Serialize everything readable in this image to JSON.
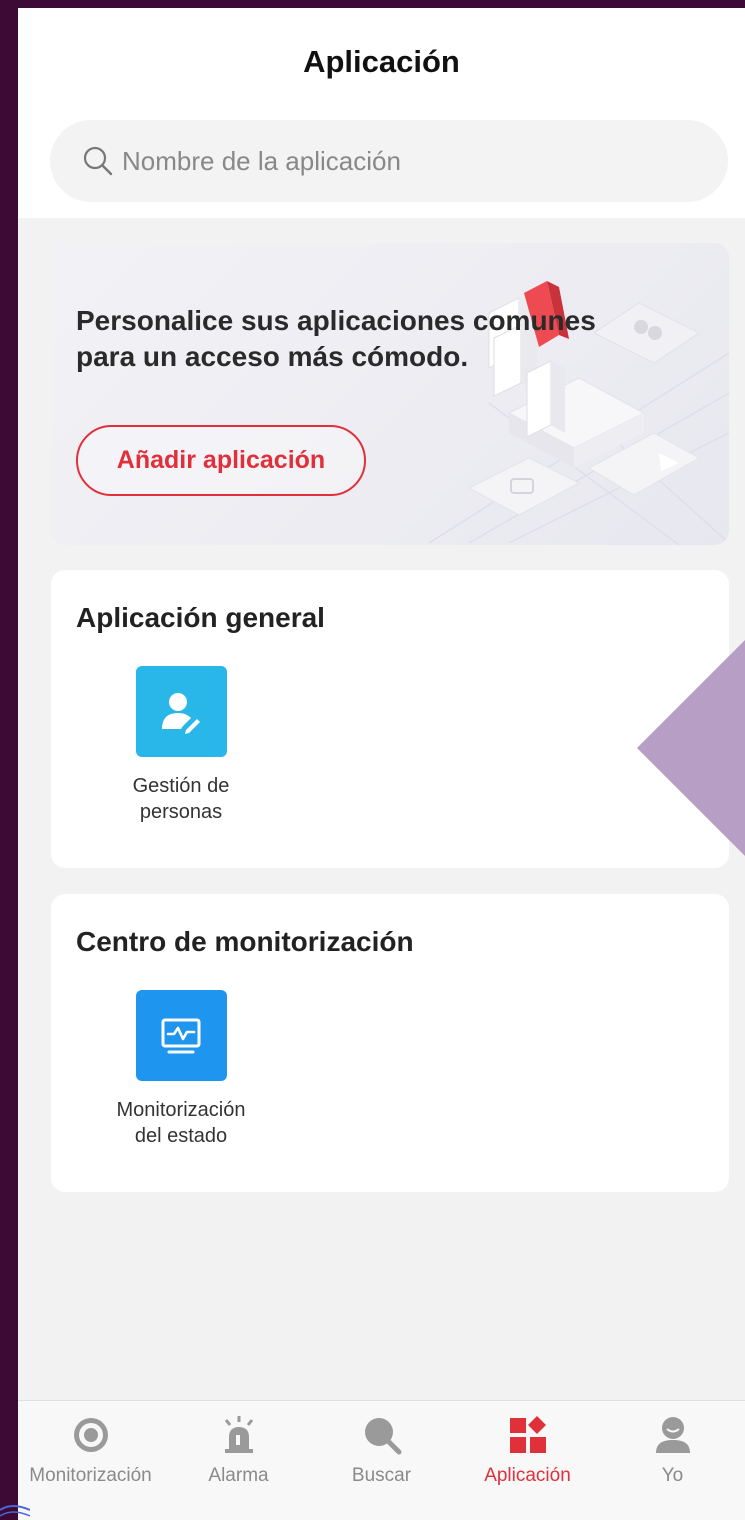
{
  "header": {
    "title": "Aplicación",
    "search_placeholder": "Nombre de la aplicación"
  },
  "promo": {
    "text_line1": "Personalice sus aplicaciones comunes",
    "text_line2": "para un acceso más cómodo.",
    "button_label": "Añadir aplicación"
  },
  "sections": [
    {
      "title": "Aplicación general",
      "apps": [
        {
          "label_line1": "Gestión de",
          "label_line2": "personas",
          "icon": "person-edit-icon",
          "color": "#29b6e8"
        }
      ]
    },
    {
      "title": "Centro de monitorización",
      "apps": [
        {
          "label_line1": "Monitorización",
          "label_line2": "del estado",
          "icon": "status-monitor-icon",
          "color": "#1e96f0"
        }
      ]
    }
  ],
  "tabbar": {
    "active": "Aplicación",
    "accent": "#e0303a",
    "tabs": [
      {
        "label": "Monitorización",
        "icon": "camera-icon"
      },
      {
        "label": "Alarma",
        "icon": "alarm-icon"
      },
      {
        "label": "Buscar",
        "icon": "search-icon"
      },
      {
        "label": "Aplicación",
        "icon": "apps-grid-icon"
      },
      {
        "label": "Yo",
        "icon": "user-icon"
      }
    ]
  }
}
